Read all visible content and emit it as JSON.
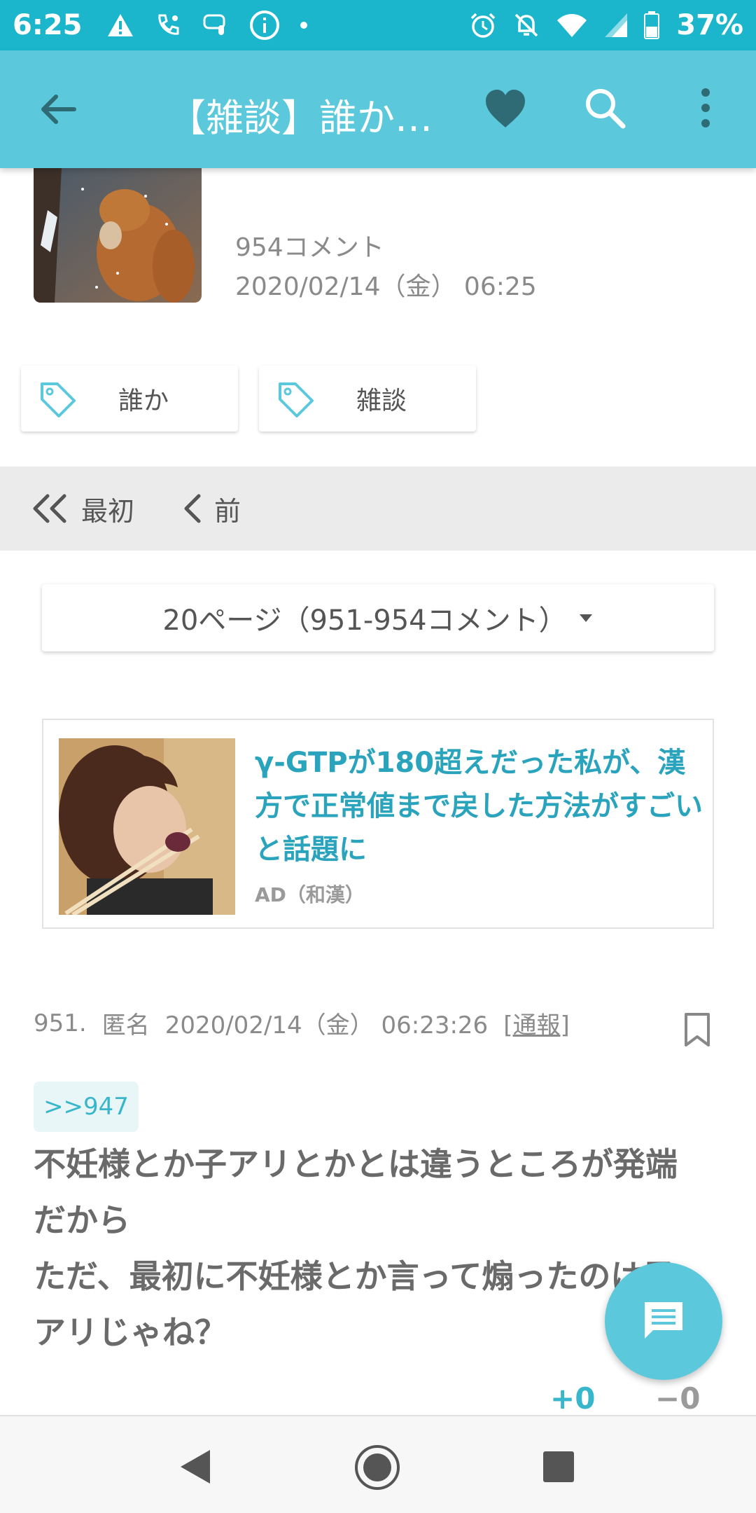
{
  "status_bar": {
    "time": "6:25",
    "battery_percent": "37%",
    "icons_left": [
      "warning-icon",
      "phone-wifi-icon",
      "voicemail-icon",
      "info-icon",
      "dot-icon"
    ],
    "icons_right": [
      "alarm-icon",
      "bell-off-icon",
      "wifi-icon",
      "signal-icon",
      "battery-icon"
    ]
  },
  "app_bar": {
    "title": "【雑談】誰か…",
    "accent_color": "#5bc9db"
  },
  "thread": {
    "comment_count": "954コメント",
    "date": "2020/02/14（金） 06:25"
  },
  "tags": [
    {
      "label": "誰か"
    },
    {
      "label": "雑談"
    }
  ],
  "pager": {
    "first_label": "最初",
    "prev_label": "前"
  },
  "page_select": {
    "value": "20ページ（951-954コメント）"
  },
  "ad": {
    "title": "γ-GTPが180超えだった私が、漢方で正常値まで戻した方法がすごいと話題に",
    "label": "AD（和漢）"
  },
  "comment": {
    "number": "951.",
    "author": "匿名",
    "datetime": "2020/02/14（金） 06:23:26",
    "report_prefix": "[",
    "report_label": "通報",
    "report_suffix": "]",
    "reply_to": ">>947",
    "body_line1": "不妊様とか子アリとかとは違うところが発端",
    "body_line2": "だから",
    "body_line3": "ただ、最初に不妊様とか言って煽ったのは子",
    "body_line4": "アリじゃね？",
    "votes_plus": "+0",
    "votes_minus": "−0"
  }
}
